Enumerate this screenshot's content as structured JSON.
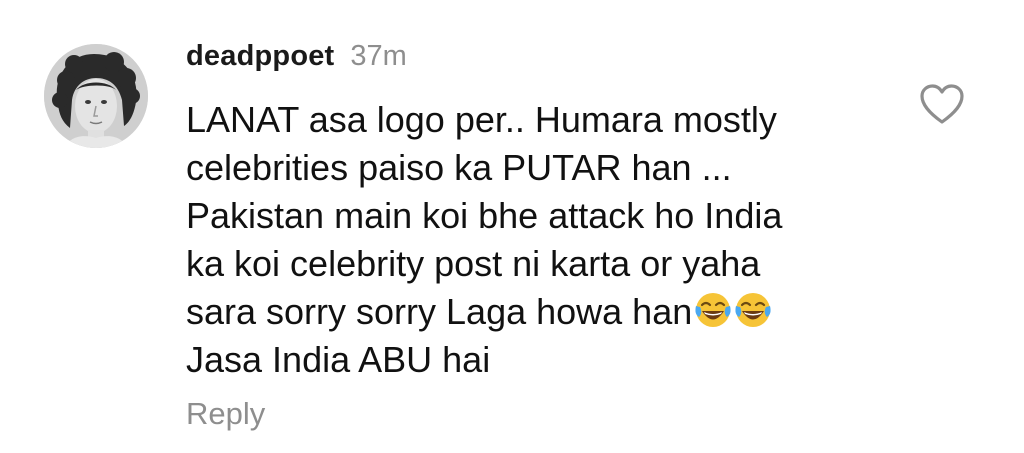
{
  "comment": {
    "username": "deadppoet",
    "time": "37m",
    "lines": [
      "LANAT asa logo per.. Humara mostly",
      "celebrities paiso ka PUTAR han ...",
      "Pakistan main koi bhe attack ho India",
      "ka koi celebrity post ni karta or yaha",
      "sara sorry sorry Laga howa han",
      "Jasa India ABU hai"
    ],
    "emoji": [
      "laughing-tears-emoji",
      "laughing-tears-emoji"
    ],
    "reply_label": "Reply",
    "like_icon": "heart-outline-icon"
  },
  "colors": {
    "text": "#111111",
    "muted": "#8e8e8e",
    "emoji_face": "#f6c437"
  }
}
